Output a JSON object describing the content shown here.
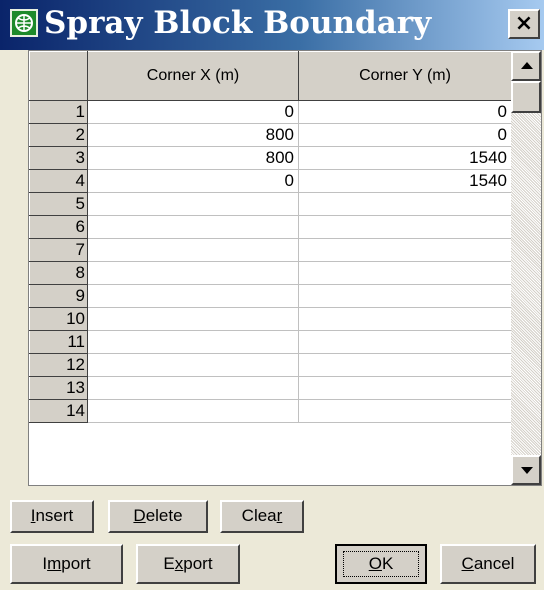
{
  "window": {
    "title": "Spray Block Boundary",
    "close_label": "×"
  },
  "grid": {
    "columns": [
      "Corner X (m)",
      "Corner Y (m)"
    ],
    "rows": [
      {
        "num": "1",
        "x": "0",
        "y": "0"
      },
      {
        "num": "2",
        "x": "800",
        "y": "0"
      },
      {
        "num": "3",
        "x": "800",
        "y": "1540"
      },
      {
        "num": "4",
        "x": "0",
        "y": "1540"
      },
      {
        "num": "5",
        "x": "",
        "y": ""
      },
      {
        "num": "6",
        "x": "",
        "y": ""
      },
      {
        "num": "7",
        "x": "",
        "y": ""
      },
      {
        "num": "8",
        "x": "",
        "y": ""
      },
      {
        "num": "9",
        "x": "",
        "y": ""
      },
      {
        "num": "10",
        "x": "",
        "y": ""
      },
      {
        "num": "11",
        "x": "",
        "y": ""
      },
      {
        "num": "12",
        "x": "",
        "y": ""
      },
      {
        "num": "13",
        "x": "",
        "y": ""
      },
      {
        "num": "14",
        "x": "",
        "y": ""
      }
    ]
  },
  "buttons": {
    "insert": {
      "pre": "",
      "key": "I",
      "post": "nsert"
    },
    "delete": {
      "pre": "",
      "key": "D",
      "post": "elete"
    },
    "clear": {
      "pre": "Clea",
      "key": "r",
      "post": ""
    },
    "import": {
      "pre": "I",
      "key": "m",
      "post": "port"
    },
    "export": {
      "pre": "E",
      "key": "x",
      "post": "port"
    },
    "ok": {
      "pre": "",
      "key": "O",
      "post": "K"
    },
    "cancel": {
      "pre": "",
      "key": "C",
      "post": "ancel"
    }
  },
  "colors": {
    "title_bar_start": "#0a246a",
    "title_bar_end": "#a6caf0",
    "face": "#d4d0c8",
    "app_icon": "#1d8a2a"
  },
  "icons": {
    "app": "globe-icon",
    "close": "close-icon",
    "scroll_up": "arrow-up-icon",
    "scroll_down": "arrow-down-icon"
  }
}
